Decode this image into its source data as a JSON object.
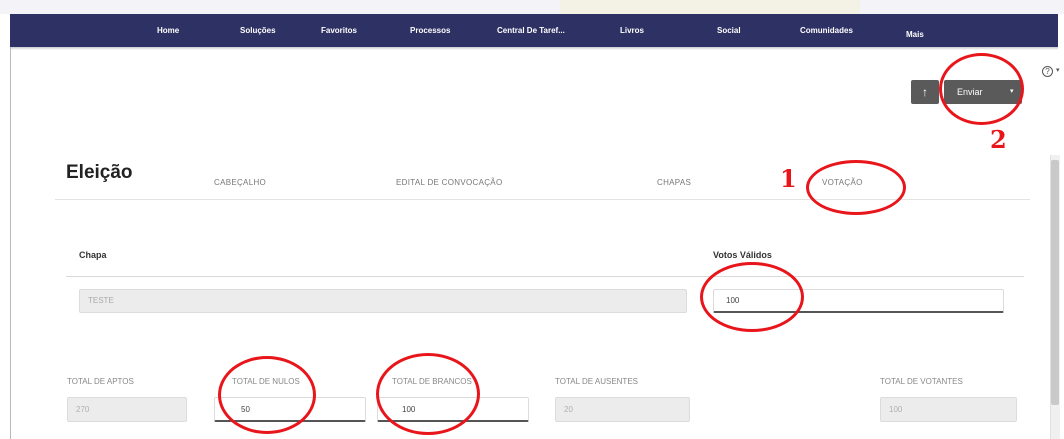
{
  "navbar": {
    "items": [
      {
        "label": "Home"
      },
      {
        "label": "Soluções"
      },
      {
        "label": "Favoritos"
      },
      {
        "label": "Processos"
      },
      {
        "label": "Central De Taref..."
      },
      {
        "label": "Livros"
      },
      {
        "label": "Social"
      },
      {
        "label": "Comunidades"
      },
      {
        "label": "Mais"
      }
    ]
  },
  "toolbar": {
    "upload_icon": "↑",
    "send_label": "Enviar",
    "send_caret": "▾",
    "help_icon": "?",
    "help_caret": "▾"
  },
  "page": {
    "title": "Eleição"
  },
  "tabs": [
    {
      "label": "CABEÇALHO"
    },
    {
      "label": "EDITAL DE CONVOCAÇÃO"
    },
    {
      "label": "CHAPAS"
    },
    {
      "label": "VOTAÇÃO"
    }
  ],
  "chapa_table": {
    "col_chapa": "Chapa",
    "col_votos": "Votos Válidos",
    "chapa_value": "TESTE",
    "votos_value": "100"
  },
  "totals": {
    "aptos_label": "TOTAL DE APTOS",
    "aptos_value": "270",
    "nulos_label": "TOTAL DE NULOS",
    "nulos_value": "50",
    "brancos_label": "TOTAL DE BRANCOS",
    "brancos_value": "100",
    "ausentes_label": "TOTAL DE AUSENTES",
    "ausentes_value": "20",
    "votantes_label": "TOTAL DE VOTANTES",
    "votantes_value": "100"
  },
  "annotations": {
    "step1": "1",
    "step2": "2",
    "color": "#e8161b"
  },
  "colors": {
    "navbar": "#2d3163",
    "button": "#5a5a5a"
  }
}
